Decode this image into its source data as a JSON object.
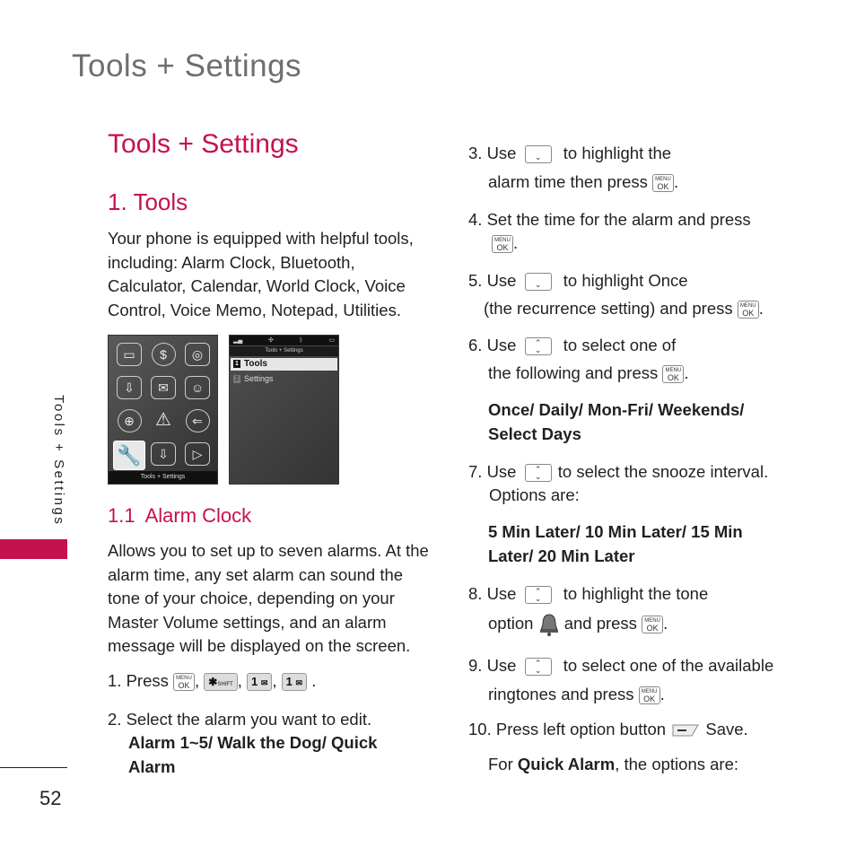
{
  "page": {
    "header": "Tools + Settings",
    "side_label": "Tools + Settings",
    "page_number": "52",
    "accent_color": "#c4124f"
  },
  "left": {
    "section_title": "Tools + Settings",
    "tools_heading": "1. Tools",
    "tools_body": "Your phone is equipped with helpful tools, including: Alarm Clock, Bluetooth, Calculator, Calendar, World Clock, Voice Control, Voice Memo, Notepad, Utilities.",
    "phone1": {
      "icons": [
        "briefcase-icon",
        "dollar-icon",
        "camera-icon",
        "shopping-cart-icon",
        "envelope-icon",
        "contacts-icon",
        "globe-icon",
        "warning-icon",
        "back-arrow-icon",
        "wrench-icon",
        "folder-download-icon",
        "play-icon"
      ],
      "caption": "Tools + Settings"
    },
    "phone2": {
      "title": "Tools + Settings",
      "items": [
        {
          "num": "1",
          "label": "Tools"
        },
        {
          "num": "2",
          "label": "Settings"
        }
      ]
    },
    "alarm_heading": "1.1  Alarm Clock",
    "alarm_body": "Allows you to set up to seven alarms. At the alarm time, any set alarm can sound the tone of your choice, depending on your Master Volume settings, and an alarm message will be displayed on the screen.",
    "step1": {
      "prefix": "1. Press",
      "keys": [
        "MENU OK",
        "* SHIFT",
        "1",
        "1"
      ]
    },
    "step2": {
      "text": "2. Select the alarm you want to edit.",
      "options": "Alarm 1~5/ Walk the Dog/ Quick Alarm"
    }
  },
  "right": {
    "step3": {
      "a": "3. Use",
      "b": "to highlight the",
      "c": "alarm time then press",
      "d": "."
    },
    "step4": {
      "a": "4. Set the time for the alarm and press",
      "d": "."
    },
    "step5": {
      "a": "5. Use",
      "b": "to highlight Once",
      "c": "(the recurrence setting) and press",
      "d": "."
    },
    "step6": {
      "a": "6. Use",
      "b": "to select one of",
      "c": "the following and press",
      "d": ".",
      "options": "Once/ Daily/ Mon-Fri/ Weekends/ Select Days"
    },
    "step7": {
      "a": "7.  Use",
      "b": "to select the snooze interval.",
      "c": "Options are:",
      "options": "5 Min Later/ 10 Min Later/ 15 Min Later/ 20 Min Later"
    },
    "step8": {
      "a": "8. Use",
      "b": "to highlight the tone",
      "c": "option",
      "c2": "and press",
      "d": "."
    },
    "step9": {
      "a": "9. Use",
      "b": "to select one of the available",
      "c": "ringtones and press",
      "d": "."
    },
    "step10": {
      "a": "10. Press left option button",
      "b": "Save."
    },
    "quick": {
      "a": "For",
      "b": "Quick Alarm",
      "c": ", the options are:"
    }
  },
  "keys": {
    "menu_top": "MENU",
    "menu_ok": "OK",
    "star": "✱",
    "shift": "SHIFT",
    "one": "1",
    "env": "✉"
  }
}
